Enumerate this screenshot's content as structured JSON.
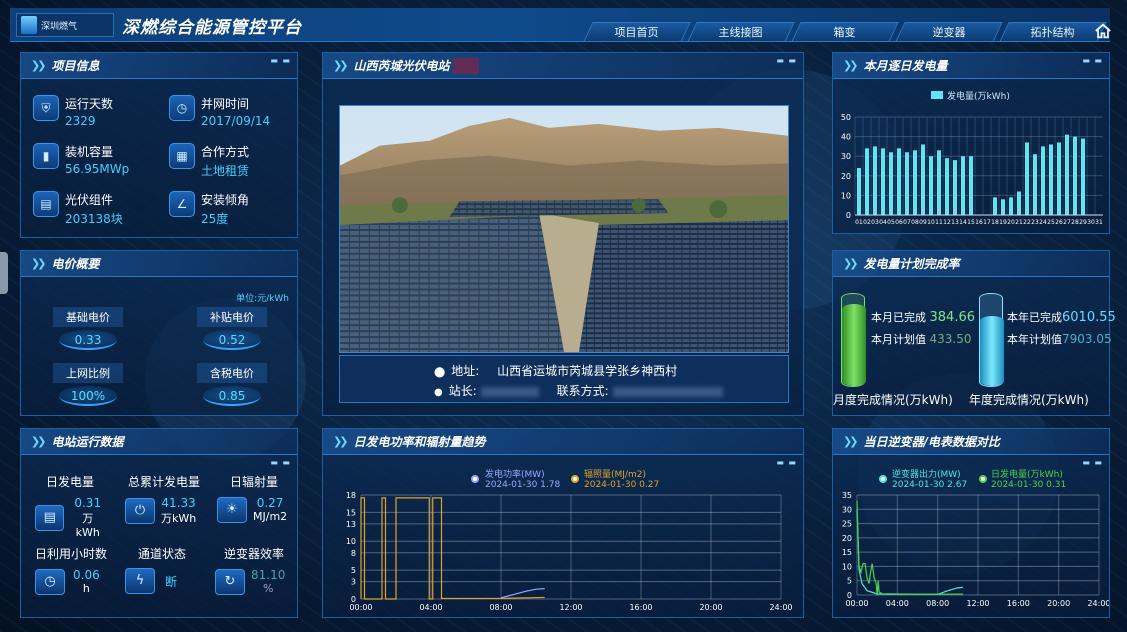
{
  "header": {
    "logo_text": "深圳燃气",
    "title": "深燃综合能源管控平台",
    "nav": [
      "项目首页",
      "主线接图",
      "箱变",
      "逆变器",
      "拓扑结构"
    ]
  },
  "project_info": {
    "title": "项目信息",
    "items": [
      {
        "label": "运行天数",
        "value": "2329",
        "icon": "shield-icon"
      },
      {
        "label": "并网时间",
        "value": "2017/09/14",
        "icon": "clock-icon"
      },
      {
        "label": "装机容量",
        "value": "56.95MWp",
        "icon": "battery-icon"
      },
      {
        "label": "合作方式",
        "value": "土地租赁",
        "icon": "grid-icon"
      },
      {
        "label": "光伏组件",
        "value": "203138块",
        "icon": "solar-panel-icon"
      },
      {
        "label": "安装倾角",
        "value": "25度",
        "icon": "angle-icon"
      }
    ]
  },
  "price": {
    "title": "电价概要",
    "unit": "单位:元/kWh",
    "items": [
      {
        "label": "基础电价",
        "value": "0.33"
      },
      {
        "label": "补贴电价",
        "value": "0.52"
      },
      {
        "label": "上网比例",
        "value": "100%"
      },
      {
        "label": "含税电价",
        "value": "0.85"
      }
    ]
  },
  "station": {
    "title": "山西芮城光伏电站",
    "address_label": "地址:",
    "address": "山西省运城市芮城县学张乡神西村",
    "manager_label": "站长:",
    "contact_label": "联系方式:"
  },
  "running": {
    "title": "电站运行数据",
    "items": [
      {
        "label": "日发电量",
        "value": "0.31",
        "unit": "万kWh",
        "icon": "solar-panel-icon"
      },
      {
        "label": "总累计发电量",
        "value": "41.33",
        "unit": "万kWh",
        "icon": "power-icon"
      },
      {
        "label": "日辐射量",
        "value": "0.27",
        "unit": "MJ/m2",
        "icon": "sun-icon"
      },
      {
        "label": "日利用小时数",
        "value": "0.06",
        "unit": "h",
        "icon": "clock-icon"
      },
      {
        "label": "通道状态",
        "value": "断",
        "unit": "",
        "icon": "lightning-icon"
      },
      {
        "label": "逆变器效率",
        "value": "81.10",
        "unit": "%",
        "icon": "refresh-icon"
      }
    ]
  },
  "daily_gen": {
    "title": "本月逐日发电量",
    "legend": "发电量(万kWh)"
  },
  "completion": {
    "title": "发电量计划完成率",
    "month_done_label": "本月已完成",
    "month_done": "384.66",
    "month_plan_label": "本月计划值",
    "month_plan": "433.50",
    "year_done_label": "本年已完成",
    "year_done": "6010.55",
    "year_plan_label": "本年计划值",
    "year_plan": "7903.05",
    "month_caption": "月度完成情况(万kWh)",
    "year_caption": "年度完成情况(万kWh)",
    "month_ratio": 0.887,
    "year_ratio": 0.76
  },
  "trend": {
    "title": "日发电功率和辐射量趋势",
    "legend_power": "发电功率(MW)",
    "legend_power_info": "2024-01-30 1.78",
    "legend_rad": "辐照量(MJ/m2)",
    "legend_rad_info": "2024-01-30 0.27"
  },
  "compare": {
    "title": "当日逆变器/电表数据对比",
    "legend_inv": "逆变器出力(MW)",
    "legend_inv_info": "2024-01-30 2.67",
    "legend_meter": "日发电量(万kWh)",
    "legend_meter_info": "2024-01-30 0.31"
  },
  "colors": {
    "accent": "#3fd2ff",
    "bar": "#5ee6f2",
    "power_line": "#9aa9ff",
    "rad_line": "#e0a32a",
    "inv_line": "#4ee8d8",
    "meter_line": "#4bd34a"
  },
  "chart_data": [
    {
      "type": "bar",
      "title": "本月逐日发电量",
      "categories": [
        "01",
        "02",
        "03",
        "04",
        "05",
        "06",
        "07",
        "08",
        "09",
        "10",
        "11",
        "12",
        "13",
        "14",
        "15",
        "16",
        "17",
        "18",
        "19",
        "20",
        "21",
        "22",
        "23",
        "24",
        "25",
        "26",
        "27",
        "28",
        "29",
        "30",
        "31"
      ],
      "series": [
        {
          "name": "发电量(万kWh)",
          "values": [
            24,
            34,
            35,
            34,
            32,
            34,
            32,
            33,
            36,
            30,
            33,
            29,
            28,
            30,
            30,
            0,
            0,
            9,
            8,
            9,
            12,
            37,
            31,
            35,
            36,
            37,
            41,
            40,
            39,
            0,
            0
          ]
        }
      ],
      "ylim": [
        0,
        50
      ],
      "yticks": [
        0,
        10,
        20,
        30,
        40,
        50
      ]
    },
    {
      "type": "line",
      "title": "日发电功率和辐射量趋势",
      "xticks": [
        "00:00",
        "04:00",
        "08:00",
        "12:00",
        "16:00",
        "20:00",
        "24:00"
      ],
      "ylim": [
        0,
        18
      ],
      "yticks": [
        0,
        3,
        5,
        8,
        10,
        13,
        15,
        18
      ],
      "series": [
        {
          "name": "发电功率(MW)",
          "x": [
            8.0,
            8.5,
            9.0,
            9.5,
            10.0,
            10.5
          ],
          "values": [
            0.2,
            0.6,
            1.0,
            1.4,
            1.7,
            1.8
          ]
        },
        {
          "name": "辐照量(MJ/m2)",
          "x": [
            0.0,
            0.0,
            0.2,
            0.2,
            1.2,
            1.2,
            1.4,
            1.4,
            2.0,
            2.0,
            3.9,
            3.9,
            4.1,
            4.1,
            4.6,
            4.6,
            8.0,
            10.5
          ],
          "values": [
            0,
            17.5,
            17.5,
            0,
            0,
            17.5,
            17.5,
            0,
            0,
            17.5,
            17.5,
            0,
            0,
            17.5,
            17.5,
            0.1,
            0.1,
            0.27
          ]
        }
      ]
    },
    {
      "type": "line",
      "title": "当日逆变器/电表数据对比",
      "xticks": [
        "00:00",
        "04:00",
        "08:00",
        "12:00",
        "16:00",
        "20:00",
        "24:00"
      ],
      "ylim": [
        0,
        35
      ],
      "yticks": [
        0,
        5,
        10,
        15,
        20,
        25,
        30,
        35
      ],
      "series": [
        {
          "name": "逆变器出力(MW)",
          "x": [
            0.0,
            0.1,
            0.2,
            0.5,
            1.0,
            2.0,
            8.0,
            9.0,
            10.0,
            10.5
          ],
          "values": [
            30,
            20,
            9,
            4,
            1.5,
            0.4,
            0.2,
            1.5,
            2.5,
            2.67
          ]
        },
        {
          "name": "日发电量(万kWh)",
          "x": [
            0.0,
            0.1,
            0.2,
            0.4,
            0.6,
            0.8,
            1.0,
            1.2,
            1.3,
            1.5,
            1.7,
            1.9,
            2.0,
            2.1,
            2.2,
            2.6,
            3.0,
            10.5
          ],
          "values": [
            33,
            20,
            10,
            8,
            11,
            11,
            6,
            4,
            7,
            11,
            6,
            4,
            0,
            5,
            1,
            0.3,
            0.2,
            0.31
          ]
        }
      ]
    }
  ]
}
